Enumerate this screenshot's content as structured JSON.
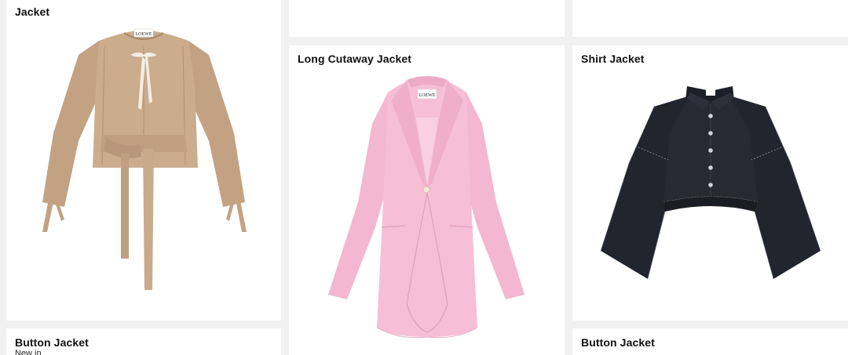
{
  "products": [
    {
      "title": "Jacket",
      "image": "beige-tie-jacket"
    },
    {
      "title": "",
      "image": ""
    },
    {
      "title": "",
      "image": ""
    },
    {
      "title": "Long Cutaway Jacket",
      "image": "pink-cutaway-jacket",
      "label_text": "LOEWE"
    },
    {
      "title": "Shirt Jacket",
      "image": "navy-cape-shirt-jacket"
    },
    {
      "title": "Button Jacket",
      "badge": "New in",
      "image": ""
    },
    {
      "title": "Button Jacket",
      "image": ""
    }
  ],
  "brand_label": "LOEWE",
  "colors": {
    "page_bg": "#f1f1f1",
    "card_bg": "#ffffff",
    "beige": "#c8a98b",
    "pink": "#f5bcd3",
    "navy": "#23262f"
  }
}
